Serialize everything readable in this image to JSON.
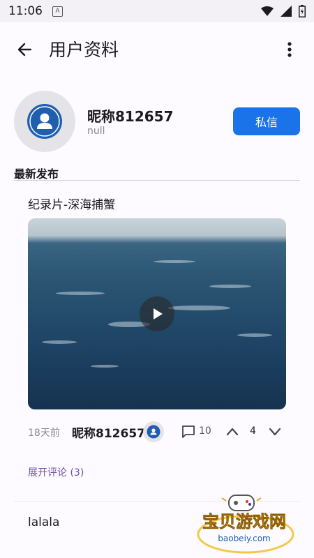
{
  "status_bar": {
    "time": "11:06",
    "notification_glyph": "A"
  },
  "app_bar": {
    "title": "用户资料"
  },
  "profile": {
    "nickname": "昵称812657",
    "bio": "null",
    "message_button": "私信"
  },
  "section": {
    "title": "最新发布"
  },
  "posts": [
    {
      "title": "纪录片-深海捕蟹",
      "time": "18天前",
      "author": "昵称812657",
      "comments": "10",
      "votes": "4",
      "expand_label": "展开评论 (3)"
    },
    {
      "title": "lalala"
    }
  ],
  "watermark": {
    "text": "宝贝游戏网",
    "url": "baobeiy.com"
  },
  "colors": {
    "accent": "#1a73e8",
    "link": "#6b54a8",
    "avatar_icon": "#1f5fae"
  }
}
